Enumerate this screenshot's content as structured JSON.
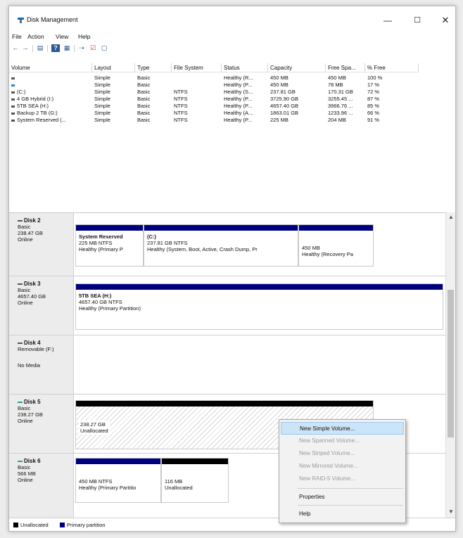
{
  "window": {
    "title": "Disk Management"
  },
  "menu": [
    "File",
    "Action",
    "View",
    "Help"
  ],
  "toolbar": {
    "back_glyph": "←",
    "forward_glyph": "→",
    "list_glyph": "▤",
    "help_glyph": "?",
    "panes_glyph": "▦",
    "connect_glyph": "⇢",
    "check_glyph": "☑",
    "view_glyph": "▢"
  },
  "icons": [
    "back-icon",
    "forward-icon",
    "console-tree-icon",
    "help-icon",
    "panes-icon",
    "rescan-icon",
    "check-icon",
    "view-icon"
  ],
  "volume_table": {
    "columns": [
      "Volume",
      "Layout",
      "Type",
      "File System",
      "Status",
      "Capacity",
      "Free Spa...",
      "% Free"
    ],
    "rows": [
      [
        "",
        "Simple",
        "Basic",
        "",
        "Healthy (R...",
        "450 MB",
        "450 MB",
        "100 %"
      ],
      [
        "",
        "Simple",
        "Basic",
        "",
        "Healthy (P...",
        "450 MB",
        "78 MB",
        "17 %"
      ],
      [
        "(C:)",
        "Simple",
        "Basic",
        "NTFS",
        "Healthy (S...",
        "237.81 GB",
        "170.31 GB",
        "72 %"
      ],
      [
        "4 GB Hybrid (I:)",
        "Simple",
        "Basic",
        "NTFS",
        "Healthy (P...",
        "3725.90 GB",
        "3255.45 ...",
        "87 %"
      ],
      [
        "5TB SEA (H:)",
        "Simple",
        "Basic",
        "NTFS",
        "Healthy (P...",
        "4657.40 GB",
        "3966.76 ...",
        "85 %"
      ],
      [
        "Backup 2 TB (G:)",
        "Simple",
        "Basic",
        "NTFS",
        "Healthy (A...",
        "1863.01 GB",
        "1233.96 ...",
        "66 %"
      ],
      [
        "System Reserved (...",
        "Simple",
        "Basic",
        "NTFS",
        "Healthy (P...",
        "225 MB",
        "204 MB",
        "91 %"
      ]
    ]
  },
  "disks": [
    {
      "name": "Disk 2",
      "type": "Basic",
      "size": "238.47 GB",
      "state": "Online",
      "partitions": [
        {
          "title": "System Reserved",
          "line1": "225 MB NTFS",
          "line2": "Healthy (Primary P"
        },
        {
          "title": "(C:)",
          "line1": "237.81 GB NTFS",
          "line2": "Healthy (System, Boot, Active, Crash Dump, Pr"
        },
        {
          "title": "",
          "line1": "450 MB",
          "line2": "Healthy (Recovery Pa"
        }
      ]
    },
    {
      "name": "Disk 3",
      "type": "Basic",
      "size": "4657.40 GB",
      "state": "Online",
      "partitions": [
        {
          "title": "5TB SEA  (H:)",
          "line1": "4657.40 GB NTFS",
          "line2": "Healthy (Primary Partition)"
        }
      ]
    },
    {
      "name": "Disk 4",
      "type": "Removable (F:)",
      "size": "",
      "state": "No Media",
      "partitions": []
    },
    {
      "name": "Disk 5",
      "type": "Basic",
      "size": "238.27 GB",
      "state": "Online",
      "partitions": [
        {
          "title": "",
          "line1": "238.27 GB",
          "line2": "Unallocated"
        }
      ]
    },
    {
      "name": "Disk 6",
      "type": "Basic",
      "size": "566 MB",
      "state": "Online",
      "partitions": [
        {
          "title": "",
          "line1": "450 MB NTFS",
          "line2": "Healthy (Primary Partitio"
        },
        {
          "title": "",
          "line1": "116 MB",
          "line2": "Unallocated"
        }
      ]
    }
  ],
  "legend": [
    "Unallocated",
    "Primary partition"
  ],
  "colors": {
    "primary_partition": "#00007f",
    "unallocated": "#000000",
    "menu_highlight": "#cce4f7"
  },
  "context_menu": {
    "items": [
      {
        "label": "New Simple Volume...",
        "enabled": true
      },
      {
        "label": "New Spanned Volume...",
        "enabled": false
      },
      {
        "label": "New Striped Volume...",
        "enabled": false
      },
      {
        "label": "New Mirrored Volume...",
        "enabled": false
      },
      {
        "label": "New RAID-5 Volume...",
        "enabled": false
      },
      {
        "label": "Properties",
        "enabled": true
      },
      {
        "label": "Help",
        "enabled": true
      }
    ]
  },
  "window_controls": {
    "minimize": "—",
    "maximize": "☐",
    "close": "✕"
  },
  "scroll": {
    "up": "▲",
    "down": "▼"
  }
}
